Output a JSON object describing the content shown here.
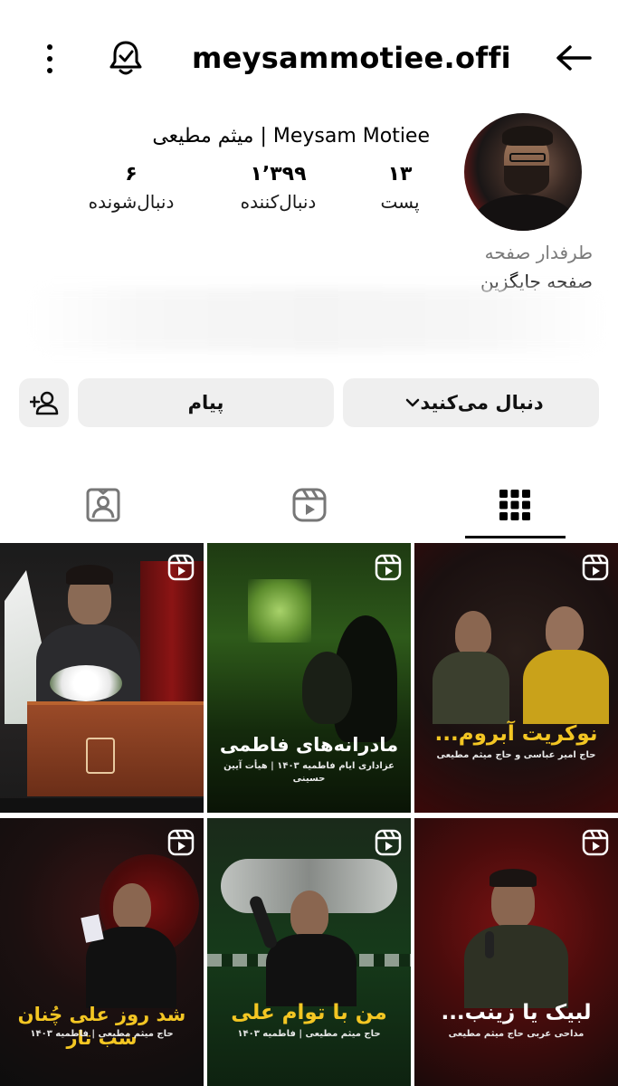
{
  "header": {
    "title": "meysammotiee.offi...",
    "back_icon": "arrow-left-icon",
    "bell_icon": "bell-icon",
    "more_icon": "more-vertical-icon"
  },
  "profile": {
    "display_name": "Meysam Motiee | میثم مطیعی",
    "stats": {
      "posts": {
        "value": "۱۳",
        "label": "پست"
      },
      "followers": {
        "value": "۱٬۳۹۹",
        "label": "دنبال‌کننده"
      },
      "following": {
        "value": "۶",
        "label": "دنبال‌شونده"
      }
    },
    "category": "طرفدار صفحه",
    "bio": "صفحه جایگزین"
  },
  "actions": {
    "follow_label": "دنبال می‌کنید",
    "message_label": "پیام",
    "add_user_icon": "add-user-icon"
  },
  "tabs": [
    {
      "name": "grid",
      "icon": "grid-icon",
      "active": true
    },
    {
      "name": "reels",
      "icon": "reels-icon",
      "active": false
    },
    {
      "name": "tagged",
      "icon": "tagged-icon",
      "active": false
    }
  ],
  "posts": [
    {
      "title": "",
      "subtitle": ""
    },
    {
      "title": "مادرانه‌های فاطمی",
      "subtitle": "عزاداری ایام فاطمیه ۱۴۰۳ | هیأت آیین حسینی"
    },
    {
      "title": "نوکریت آبروم...",
      "subtitle": "حاج امیر عباسی و حاج میثم مطیعی"
    },
    {
      "title": "شد روز علی چُنان شب تار",
      "subtitle": "حاج میثم مطیعی | فاطمیه ۱۴۰۳"
    },
    {
      "title": "من با توام علی",
      "subtitle": "حاج میثم مطیعی | فاطمیه ۱۴۰۳"
    },
    {
      "title": "لبیک یا زینب...",
      "subtitle": "مداحی عربی حاج میثم مطیعی"
    }
  ],
  "colors": {
    "button_bg": "#efefef",
    "caption_yellow": "#f3c623",
    "muted_text": "#7a7a7a"
  }
}
